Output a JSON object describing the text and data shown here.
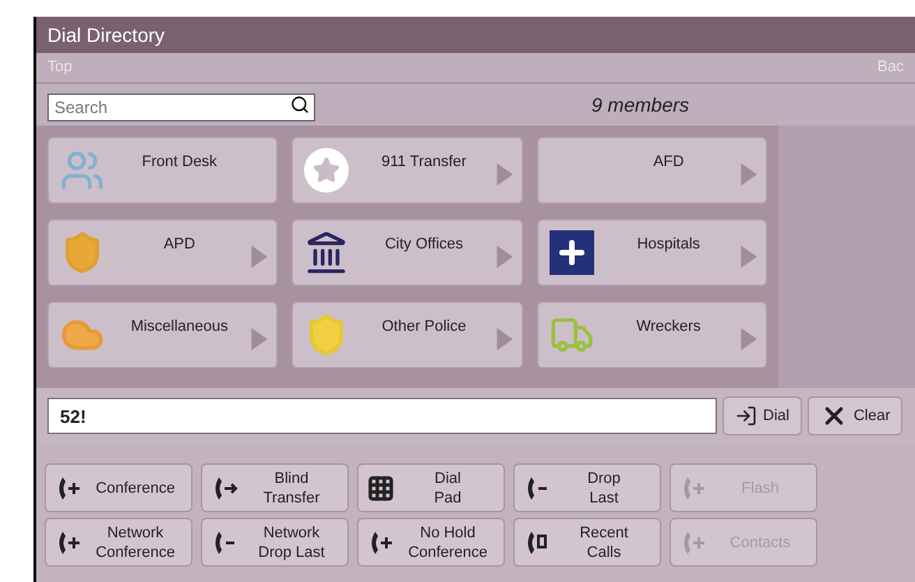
{
  "window": {
    "title": "Dial Directory"
  },
  "nav": {
    "left": "Top",
    "right": "Bac"
  },
  "search": {
    "placeholder": "Search"
  },
  "member_count": "9 members",
  "tiles": [
    {
      "label": "Front Desk",
      "kind": "people",
      "arrow": false
    },
    {
      "label": "911 Transfer",
      "kind": "star",
      "arrow": true
    },
    {
      "label": "AFD",
      "kind": "none",
      "arrow": true
    },
    {
      "label": "APD",
      "kind": "badge",
      "arrow": true
    },
    {
      "label": "City Offices",
      "kind": "building",
      "arrow": true
    },
    {
      "label": "Hospitals",
      "kind": "cross",
      "arrow": true
    },
    {
      "label": "Miscellaneous",
      "kind": "clouds",
      "arrow": true
    },
    {
      "label": "Other Police",
      "kind": "eagle",
      "arrow": true
    },
    {
      "label": "Wreckers",
      "kind": "truck",
      "arrow": true
    }
  ],
  "dial": {
    "value": "52!",
    "buttons": [
      {
        "label": "Dial",
        "kind": "dial"
      },
      {
        "label": "Clear",
        "kind": "clear"
      }
    ]
  },
  "actions": [
    {
      "label": "Conference",
      "kind": "conference",
      "disabled": false
    },
    {
      "label": "Blind\nTransfer",
      "kind": "transfer",
      "disabled": false
    },
    {
      "label": "Dial\nPad",
      "kind": "pad",
      "disabled": false
    },
    {
      "label": "Drop\nLast",
      "kind": "drop",
      "disabled": false
    },
    {
      "label": "Flash",
      "kind": "flash",
      "disabled": true
    },
    {
      "label": "Network\nConference",
      "kind": "netconf",
      "disabled": false
    },
    {
      "label": "Network\nDrop Last",
      "kind": "netdrop",
      "disabled": false
    },
    {
      "label": "No Hold\nConference",
      "kind": "nohold",
      "disabled": false
    },
    {
      "label": "Recent\nCalls",
      "kind": "recent",
      "disabled": false
    },
    {
      "label": "Contacts",
      "kind": "contacts",
      "disabled": true
    }
  ]
}
